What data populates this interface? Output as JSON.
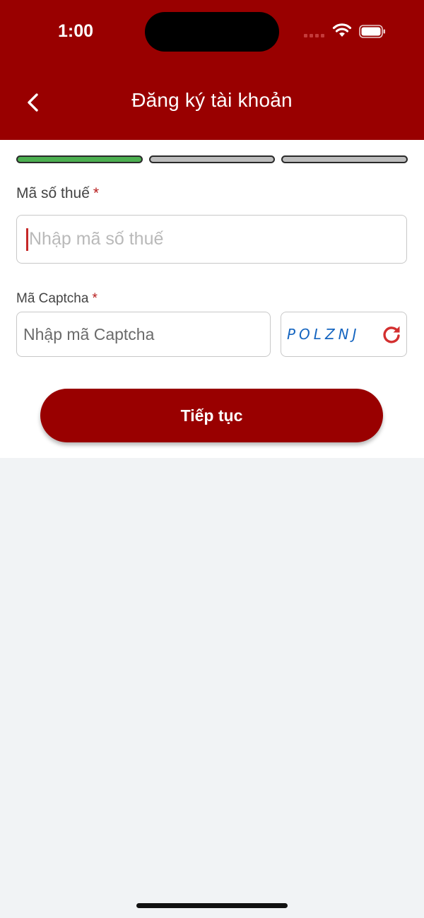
{
  "status_bar": {
    "time": "1:00"
  },
  "header": {
    "title": "Đăng ký tài khoản",
    "back_icon": "chevron-left-icon"
  },
  "progress": {
    "steps_total": 3,
    "current_step": 1,
    "active_color": "#4caf50",
    "inactive_color": "#bdbdbd"
  },
  "form": {
    "tax_code": {
      "label": "Mã số thuế",
      "required_mark": "*",
      "placeholder": "Nhập mã số thuế",
      "value": ""
    },
    "captcha": {
      "label": "Mã Captcha",
      "required_mark": "*",
      "placeholder": "Nhập mã Captcha",
      "value": "",
      "code": "POLZNJ",
      "refresh_icon": "refresh-icon"
    },
    "submit_label": "Tiếp tục"
  },
  "colors": {
    "brand": "#990000",
    "required": "#b71c1c",
    "captcha_text": "#1565c0",
    "background": "#f1f3f5"
  }
}
